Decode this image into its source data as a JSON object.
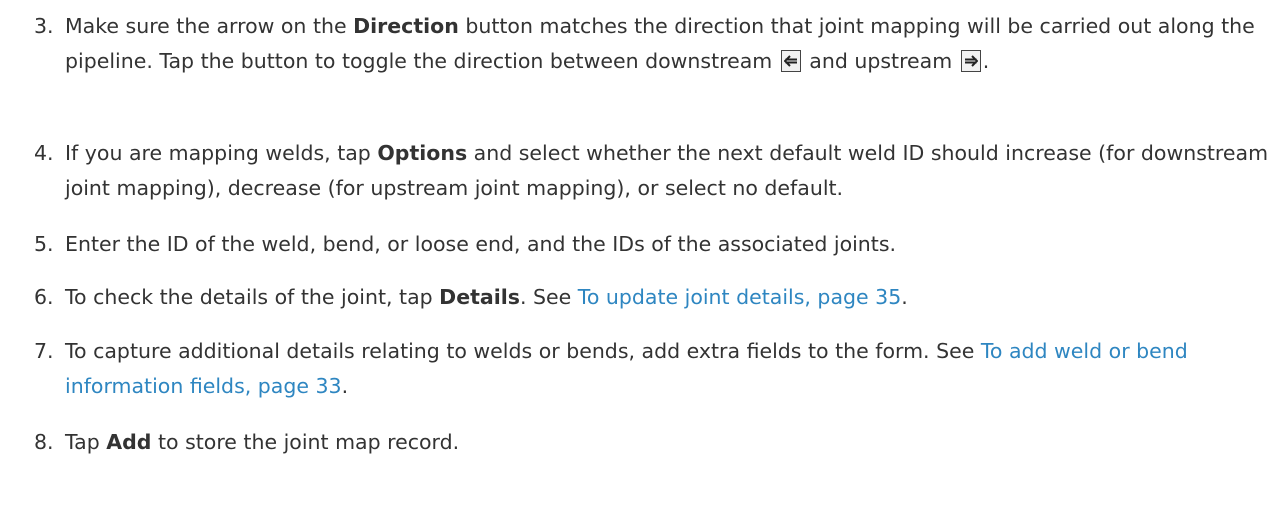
{
  "steps": [
    {
      "num": "3.",
      "parts": [
        {
          "t": "text",
          "v": "Make sure the arrow on the "
        },
        {
          "t": "bold",
          "v": "Direction"
        },
        {
          "t": "text",
          "v": " button matches the direction that joint mapping will be carried out along the pipeline. Tap the button to toggle the direction between downstream "
        },
        {
          "t": "icon",
          "v": "left-arrow-icon"
        },
        {
          "t": "text",
          "v": " and upstream "
        },
        {
          "t": "icon",
          "v": "right-arrow-icon"
        },
        {
          "t": "text",
          "v": "."
        }
      ]
    },
    {
      "num": "4.",
      "parts": [
        {
          "t": "text",
          "v": "If you are mapping welds, tap "
        },
        {
          "t": "bold",
          "v": "Options"
        },
        {
          "t": "text",
          "v": " and select whether the next default weld ID should increase (for downstream joint mapping), decrease (for upstream joint mapping), or select no default."
        }
      ]
    },
    {
      "num": "5.",
      "parts": [
        {
          "t": "text",
          "v": "Enter the ID of the weld, bend, or loose end, and the IDs of the associated joints."
        }
      ]
    },
    {
      "num": "6.",
      "parts": [
        {
          "t": "text",
          "v": "To check the details of the joint, tap "
        },
        {
          "t": "bold",
          "v": "Details"
        },
        {
          "t": "text",
          "v": ". See "
        },
        {
          "t": "link",
          "v": "To update joint details, page 35"
        },
        {
          "t": "text",
          "v": "."
        }
      ]
    },
    {
      "num": "7.",
      "parts": [
        {
          "t": "text",
          "v": "To capture additional details relating to welds or bends, add extra fields to the form. See "
        },
        {
          "t": "link",
          "v": "To add weld or bend information fields, page 33"
        },
        {
          "t": "text",
          "v": "."
        }
      ]
    },
    {
      "num": "8.",
      "parts": [
        {
          "t": "text",
          "v": "Tap "
        },
        {
          "t": "bold",
          "v": "Add"
        },
        {
          "t": "text",
          "v": " to store the joint map record."
        }
      ]
    }
  ]
}
